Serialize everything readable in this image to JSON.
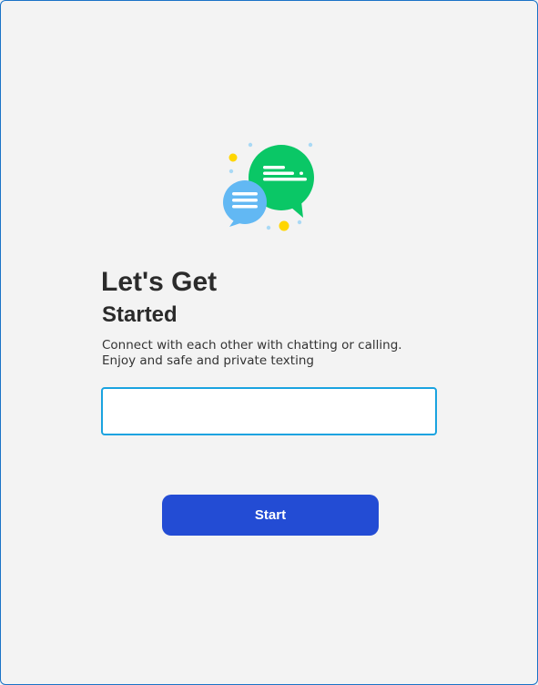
{
  "window": {
    "border_color": "#1a73c7",
    "background": "#f3f3f3"
  },
  "illustration": {
    "icon": "chat-bubbles-icon",
    "colors": {
      "green_bubble": "#0ac766",
      "blue_bubble": "#62b8f3",
      "yellow_dot": "#ffd600",
      "light_blue_dot": "#a9d9f5"
    }
  },
  "heading": {
    "line1": "Let's Get",
    "line2": "Started"
  },
  "subtitle": {
    "line1": "Connect with each other with chatting or calling.",
    "line2": "Enjoy and safe and private texting"
  },
  "name_input": {
    "value": "",
    "border_color": "#1aa3e0"
  },
  "start_button": {
    "label": "Start",
    "color": "#234cd4"
  }
}
